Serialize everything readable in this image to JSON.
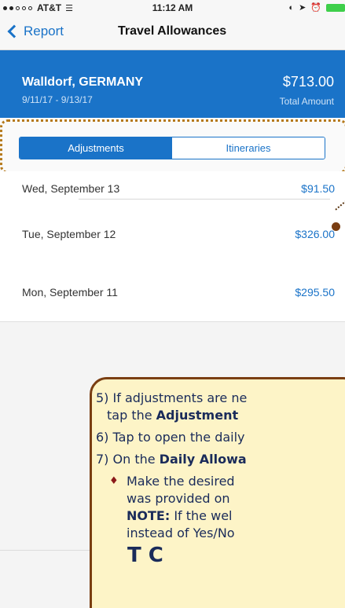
{
  "status_bar": {
    "carrier": "AT&T",
    "time": "11:12 AM"
  },
  "nav": {
    "back_label": "Report",
    "title": "Travel Allowances"
  },
  "header": {
    "location": "Walldorf, GERMANY",
    "dates": "9/11/17 - 9/13/17",
    "amount": "$713.00",
    "amount_label": "Total Amount"
  },
  "tabs": [
    {
      "label": "Adjustments",
      "active": true
    },
    {
      "label": "Itineraries",
      "active": false
    }
  ],
  "days": [
    {
      "date": "Wed, September 13",
      "amount": "$91.50"
    },
    {
      "date": "Tue, September 12",
      "amount": "$326.00"
    },
    {
      "date": "Mon, September 11",
      "amount": "$295.50"
    }
  ],
  "callout": {
    "l5_prefix": "5) If adjustments are ne",
    "l5b_prefix": "tap the ",
    "l5b_bold": "Adjustment",
    "l6": "6) Tap to open the daily",
    "l7_prefix": "7) On the ",
    "l7_bold": "Daily Allowa",
    "b1_line1": "Make the desired",
    "b1_line2": "was provided on",
    "note_bold": "NOTE:",
    "note_rest": " If the wel",
    "b1_line4": "instead of Yes/No",
    "tap_partial": "T    C"
  },
  "colors": {
    "accent": "#1a73c8",
    "callout_bg": "#fdf4c7",
    "callout_border": "#7a3e12",
    "highlight_dotted": "#b5791a"
  }
}
